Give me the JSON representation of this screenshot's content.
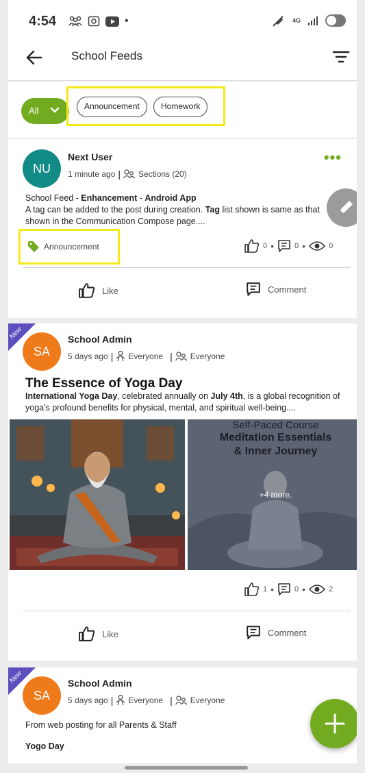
{
  "status_bar": {
    "time": "4:54",
    "network": "4G"
  },
  "app_bar": {
    "title": "School Feeds"
  },
  "filters": {
    "all_label": "All",
    "chips": [
      "Announcement",
      "Homework"
    ]
  },
  "posts": [
    {
      "initials": "NU",
      "author": "Next User",
      "time": "1 minute ago",
      "audience": "Sections (20)",
      "line1_prefix": "School Feed - ",
      "line1_bold1": "Enhancement",
      "line1_mid": " - ",
      "line1_bold2": "Android App",
      "line2_prefix": "A tag can be added to the post during creation. ",
      "line2_bold": "Tag",
      "line2_suffix": " list shown is same as that",
      "line3": "shown in the Communication Compose page....",
      "tag": "Announcement",
      "likes": "0",
      "comments": "0",
      "views": "0",
      "like_label": "Like",
      "comment_label": "Comment"
    },
    {
      "badge": "New",
      "initials": "SA",
      "author": "School Admin",
      "time": "5 days ago",
      "audience1": "Everyone",
      "audience2": "Everyone",
      "headline": "The Essence of Yoga Day",
      "body_bold1": "International Yoga Day",
      "body_mid1": ", celebrated annually on ",
      "body_bold2": "July 4th",
      "body_mid2": ", is a global recognition of",
      "body_line2": "yoga's profound benefits for physical, mental, and spiritual well-being....",
      "image_overlay": {
        "line1": "Self-Paced Course",
        "line2": "Meditation Essentials",
        "line3": "& Inner Journey",
        "more": "+4 more."
      },
      "likes": "1",
      "comments": "0",
      "views": "2",
      "like_label": "Like",
      "comment_label": "Comment"
    },
    {
      "badge": "New",
      "initials": "SA",
      "author": "School Admin",
      "time": "5 days ago",
      "audience1": "Everyone",
      "audience2": "Everyone",
      "body": "From web posting for all Parents & Staff",
      "title_bold": "Yogo Day"
    }
  ],
  "colors": {
    "accent": "#72ab1f",
    "avatar_teal": "#128b87",
    "avatar_orange": "#ef7a1a",
    "highlight": "#f4ea17"
  }
}
